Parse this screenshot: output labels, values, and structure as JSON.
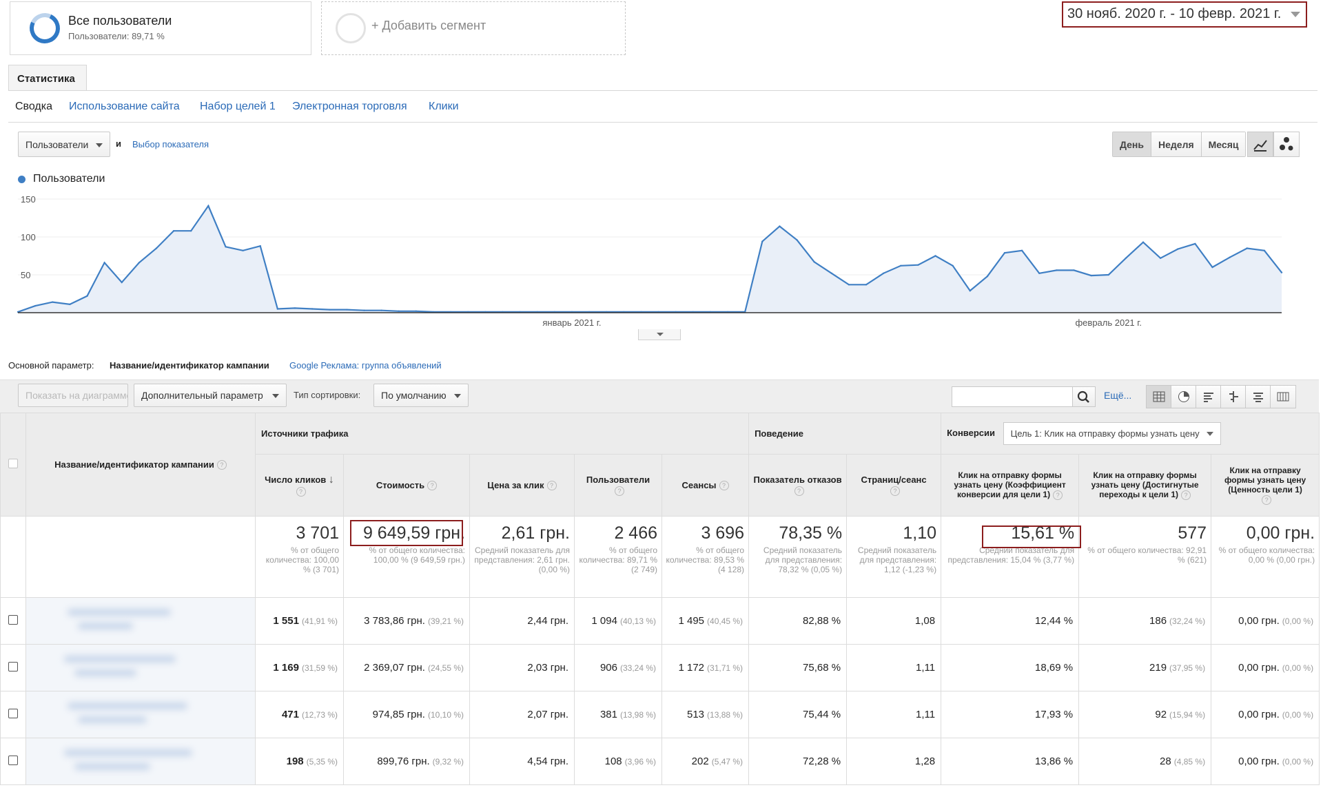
{
  "segments": {
    "all_users_title": "Все пользователи",
    "all_users_sub": "Пользователи: 89,71 %",
    "add_segment": "+ Добавить сегмент"
  },
  "date_range": "30 нояб. 2020 г. - 10 февр. 2021 г.",
  "report_tab": "Статистика",
  "subnav": [
    "Сводка",
    "Использование сайта",
    "Набор целей 1",
    "Электронная торговля",
    "Клики"
  ],
  "metric_select": "Пользователи",
  "metric_and": "и",
  "choose_metric": "Выбор показателя",
  "granularity": [
    "День",
    "Неделя",
    "Месяц"
  ],
  "chart_data": {
    "type": "area",
    "series": [
      {
        "name": "Пользователи",
        "color": "#3f7fc4",
        "values": [
          1,
          9,
          14,
          11,
          22,
          66,
          40,
          66,
          85,
          108,
          108,
          141,
          87,
          82,
          88,
          5,
          6,
          5,
          4,
          4,
          3,
          3,
          2,
          2,
          1,
          1,
          1,
          1,
          1,
          1,
          1,
          1,
          1,
          1,
          1,
          1,
          1,
          1,
          1,
          1,
          1,
          1,
          1,
          94,
          114,
          96,
          67,
          52,
          37,
          37,
          52,
          62,
          63,
          75,
          62,
          29,
          48,
          79,
          82,
          52,
          56,
          56,
          49,
          50,
          72,
          93,
          72,
          84,
          91,
          60,
          73,
          85,
          82,
          53
        ]
      }
    ],
    "yticks": [
      "150",
      "100",
      "50"
    ],
    "ylim": [
      0,
      150
    ],
    "xticks": [
      {
        "label": "январь 2021 г.",
        "index": 32
      },
      {
        "label": "февраль 2021 г.",
        "index": 63
      }
    ],
    "grid": true
  },
  "primary_dimension_label": "Основной параметр:",
  "primary_dimension_value": "Название/идентификатор кампании",
  "alt_dimension_link": "Google Реклама: группа объявлений",
  "toolbar": {
    "plot_rows": "Показать на диаграмме",
    "secondary_dim": "Дополнительный параметр",
    "sort_label": "Тип сортировки:",
    "sort_value": "По умолчанию",
    "more": "Ещё..."
  },
  "table": {
    "col_campaign": "Название/идентификатор кампании",
    "group_sources": "Источники трафика",
    "group_behavior": "Поведение",
    "group_conversions": "Конверсии",
    "goal_select": "Цель 1: Клик на отправку формы узнать цену",
    "columns": [
      "Число кликов",
      "Стоимость",
      "Цена за клик",
      "Пользователи",
      "Сеансы",
      "Показатель отказов",
      "Страниц/сеанс",
      "Клик на отправку формы узнать цену (Коэффициент конверсии для цели 1)",
      "Клик на отправку формы узнать цену (Достигнутые переходы к цели 1)",
      "Клик на отправку формы узнать цену (Ценность цели 1)"
    ],
    "totals": [
      {
        "main": "3 701",
        "sub": "% от общего количества: 100,00 % (3 701)"
      },
      {
        "main": "9 649,59 грн.",
        "sub": "% от общего количества: 100,00 % (9 649,59 грн.)"
      },
      {
        "main": "2,61 грн.",
        "sub": "Средний показатель для представления: 2,61 грн. (0,00 %)"
      },
      {
        "main": "2 466",
        "sub": "% от общего количества: 89,71 % (2 749)"
      },
      {
        "main": "3 696",
        "sub": "% от общего количества: 89,53 % (4 128)"
      },
      {
        "main": "78,35 %",
        "sub": "Средний показатель для представления: 78,32 % (0,05 %)"
      },
      {
        "main": "1,10",
        "sub": "Средний показатель для представления: 1,12 (-1,23 %)"
      },
      {
        "main": "15,61 %",
        "sub": "Средний показатель для представления: 15,04 % (3,77 %)"
      },
      {
        "main": "577",
        "sub": "% от общего количества: 92,91 % (621)"
      },
      {
        "main": "0,00 грн.",
        "sub": "% от общего количества: 0,00 % (0,00 грн.)"
      }
    ],
    "rows": [
      [
        "1 551",
        "(41,91 %)",
        "3 783,86 грн.",
        "(39,21 %)",
        "2,44 грн.",
        "1 094",
        "(40,13 %)",
        "1 495",
        "(40,45 %)",
        "82,88 %",
        "1,08",
        "12,44 %",
        "186",
        "(32,24 %)",
        "0,00 грн.",
        "(0,00 %)"
      ],
      [
        "1 169",
        "(31,59 %)",
        "2 369,07 грн.",
        "(24,55 %)",
        "2,03 грн.",
        "906",
        "(33,24 %)",
        "1 172",
        "(31,71 %)",
        "75,68 %",
        "1,11",
        "18,69 %",
        "219",
        "(37,95 %)",
        "0,00 грн.",
        "(0,00 %)"
      ],
      [
        "471",
        "(12,73 %)",
        "974,85 грн.",
        "(10,10 %)",
        "2,07 грн.",
        "381",
        "(13,98 %)",
        "513",
        "(13,88 %)",
        "75,44 %",
        "1,11",
        "17,93 %",
        "92",
        "(15,94 %)",
        "0,00 грн.",
        "(0,00 %)"
      ],
      [
        "198",
        "(5,35 %)",
        "899,76 грн.",
        "(9,32 %)",
        "4,54 грн.",
        "108",
        "(3,96 %)",
        "202",
        "(5,47 %)",
        "72,28 %",
        "1,28",
        "13,86 %",
        "28",
        "(4,85 %)",
        "0,00 грн.",
        "(0,00 %)"
      ]
    ]
  }
}
